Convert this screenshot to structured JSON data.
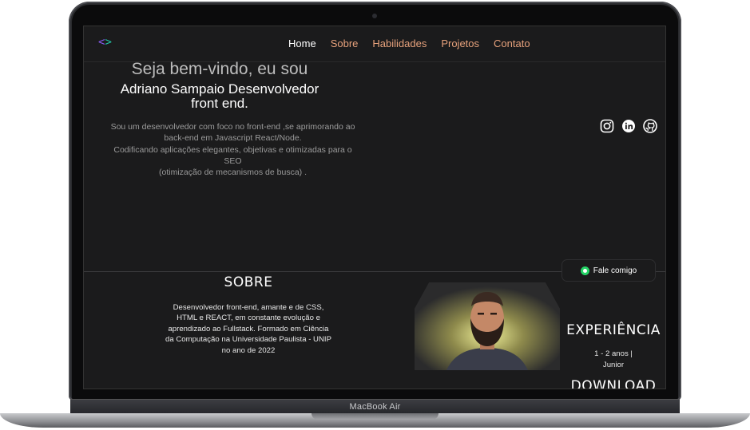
{
  "device": {
    "label": "MacBook Air"
  },
  "nav": {
    "logo": {
      "left": "<",
      "right": ">"
    },
    "links": [
      {
        "label": "Home",
        "active": true
      },
      {
        "label": "Sobre"
      },
      {
        "label": "Habilidades"
      },
      {
        "label": "Projetos"
      },
      {
        "label": "Contato"
      }
    ]
  },
  "hero": {
    "greeting": "Seja bem-vindo, eu sou",
    "name_line1": "Adriano Sampaio Desenvolvedor",
    "name_line2": "front end.",
    "description_lines": [
      "Sou um desenvolvedor com foco no front-end ,se aprimorando ao",
      "back-end em Javascript React/Node.",
      "Codificando aplicações elegantes, objetivas e otimizadas para o",
      "SEO",
      "(otimização de mecanismos de busca) ."
    ]
  },
  "social": [
    "instagram-icon",
    "linkedin-icon",
    "github-icon"
  ],
  "whatsapp": {
    "label": "Fale comigo",
    "color": "#25d366"
  },
  "sobre": {
    "title": "SOBRE",
    "lines": [
      "Desenvolvedor front-end, amante e de CSS,",
      "HTML e REACT, em constante evolução e",
      "aprendizado ao Fullstack. Formado em Ciência",
      "da Computação na Universidade Paulista - UNIP",
      "no ano de 2022"
    ]
  },
  "experiencia": {
    "title": "EXPERIÊNCIA",
    "line1": "1 - 2 anos |",
    "line2": "Junior"
  },
  "download": {
    "label": "DOWNLOAD"
  },
  "colors": {
    "accent": "#e7a27c",
    "background": "#1b1b1c",
    "logo_left": "#8a5cf6",
    "logo_right": "#22c5a6"
  }
}
